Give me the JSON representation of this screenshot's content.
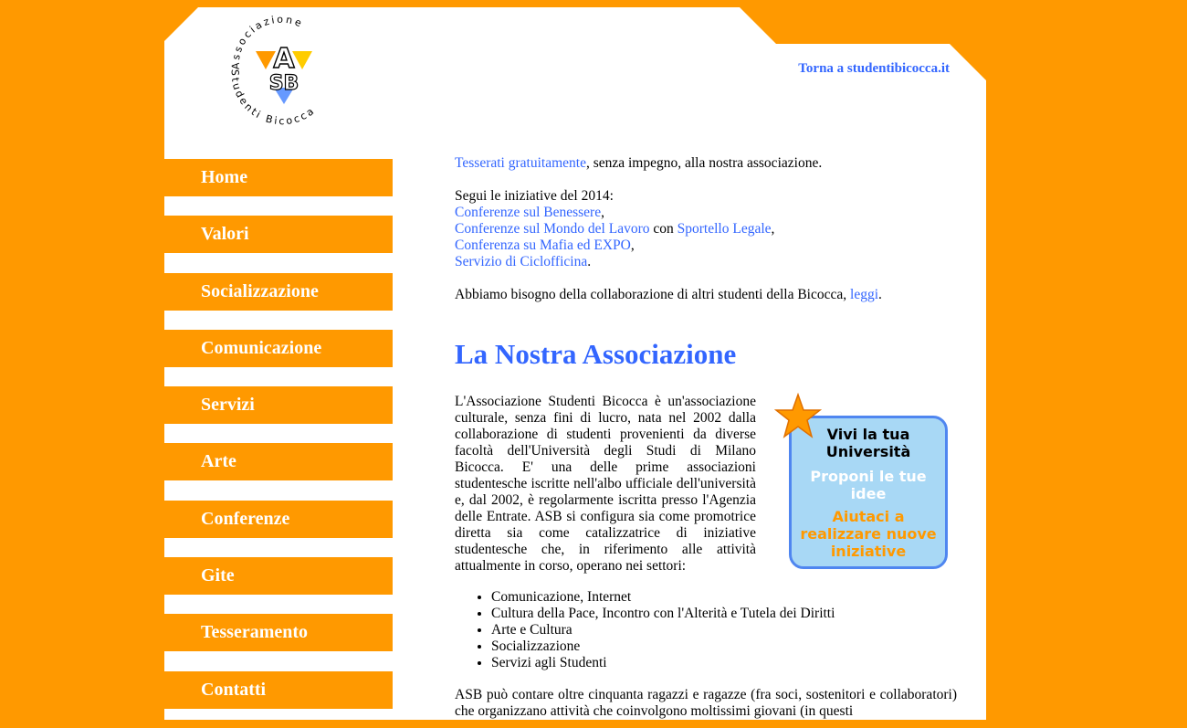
{
  "header": {
    "logo": {
      "arc_top": "Associazione",
      "arc_bottom": "Studenti Bicocca",
      "letters_a": "A",
      "letters_sb": "SB"
    },
    "back_link": "Torna a studentibicocca.it"
  },
  "nav": {
    "items": [
      {
        "label": "Home"
      },
      {
        "label": "Valori"
      },
      {
        "label": "Socializzazione"
      },
      {
        "label": "Comunicazione"
      },
      {
        "label": "Servizi"
      },
      {
        "label": "Arte"
      },
      {
        "label": "Conferenze"
      },
      {
        "label": "Gite"
      },
      {
        "label": "Tesseramento"
      },
      {
        "label": "Contatti"
      }
    ]
  },
  "intro": {
    "tessera_link": "Tesserati gratuitamente",
    "tessera_rest": ", senza impegno, alla nostra associazione.",
    "iniziative_heading": "Segui le iniziative del 2014:",
    "link_benessere": "Conferenze sul Benessere",
    "sep1": ",",
    "link_lavoro": "Conferenze sul Mondo del Lavoro",
    "word_con": " con ",
    "link_sportello": "Sportello Legale",
    "sep2": ",",
    "link_mafia": "Conferenza su Mafia ed EXPO",
    "sep3": ",",
    "link_ciclofficina": "Servizio di Ciclofficina",
    "sep4": ".",
    "collab_text": "Abbiamo bisogno della collaborazione di altri studenti della Bicocca, ",
    "collab_link": "leggi",
    "collab_end": "."
  },
  "section": {
    "title": "La Nostra Associazione",
    "body": "L'Associazione Studenti Bicocca è un'associazione culturale, senza fini di lucro, nata nel 2002 dalla collaborazione di studenti provenienti da diverse facoltà dell'Università degli Studi di Milano Bicocca. E' una delle prime associazioni studentesche iscritte nell'albo ufficiale dell'università e, dal 2002, è regolarmente iscritta presso l'Agenzia delle Entrate. ASB si configura sia come promotrice diretta sia come catalizzatrice di iniziative studentesche che, in riferimento alle attività attualmente in corso, operano nei settori:",
    "sectors": [
      "Comunicazione, Internet",
      "Cultura della Pace, Incontro con l'Alterità e Tutela dei Diritti",
      "Arte e Cultura",
      "Socializzazione",
      "Servizi agli Studenti"
    ],
    "bottom": "ASB può contare oltre cinquanta ragazzi e ragazze (fra soci, sostenitori e collaboratori) che organizzano attività che coinvolgono moltissimi giovani (in questi"
  },
  "promo": {
    "line1a": "Vivi la tua",
    "line1b": "Università",
    "line2a": "Proponi le tue",
    "line2b": "idee",
    "line3a": "Aiutaci a",
    "line3b": "realizzare nuove",
    "line3c": "iniziative"
  },
  "colors": {
    "background": "#ff9900",
    "link": "#3366ff",
    "promo_bg": "#a8d8f5",
    "promo_border": "#4f86f0"
  }
}
